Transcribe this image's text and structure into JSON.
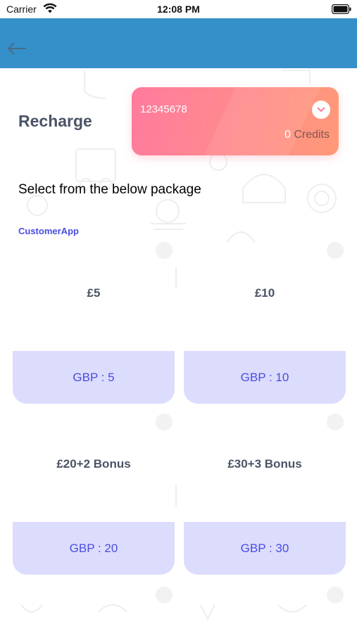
{
  "status_bar": {
    "carrier": "Carrier",
    "time": "12:08 PM"
  },
  "nav": {
    "background_color": "#3590c9",
    "back_icon": "arrow-left-icon"
  },
  "header": {
    "title": "Recharge"
  },
  "card": {
    "number": "12345678",
    "credits_value": "0",
    "credits_label": "Credits",
    "dropdown_icon": "chevron-down-icon"
  },
  "select_heading": "Select from the below package",
  "app_label": "CustomerApp",
  "packages": [
    {
      "title": "£5",
      "button_label": "GBP : 5"
    },
    {
      "title": "£10",
      "button_label": "GBP : 10"
    },
    {
      "title": "£20+2 Bonus",
      "button_label": "GBP : 20"
    },
    {
      "title": "£30+3 Bonus",
      "button_label": "GBP : 30"
    }
  ],
  "colors": {
    "accent": "#4a4de0",
    "button_bg": "#dcdcfd",
    "card_gradient_start": "#ff7b9e",
    "card_gradient_end": "#ff9a78"
  }
}
